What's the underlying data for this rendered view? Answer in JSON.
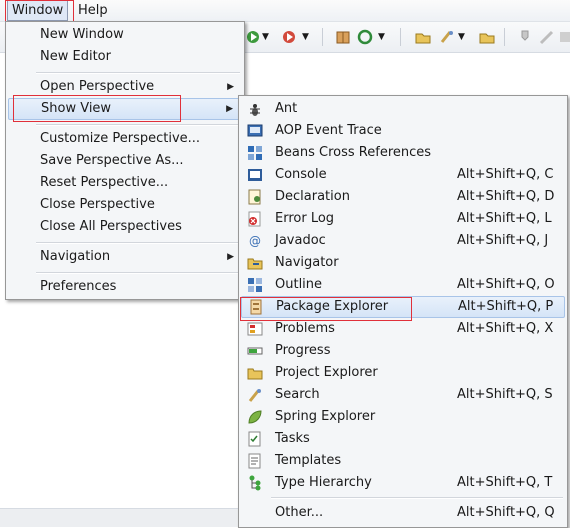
{
  "menubar": {
    "window": "Window",
    "help": "Help"
  },
  "window_menu": {
    "items": [
      {
        "label": "New Window"
      },
      {
        "label": "New Editor"
      },
      {
        "label": "Open Perspective"
      },
      {
        "label": "Show View"
      },
      {
        "label": "Customize Perspective..."
      },
      {
        "label": "Save Perspective As..."
      },
      {
        "label": "Reset Perspective..."
      },
      {
        "label": "Close Perspective"
      },
      {
        "label": "Close All Perspectives"
      },
      {
        "label": "Navigation"
      },
      {
        "label": "Preferences"
      }
    ]
  },
  "show_view_menu": {
    "items": [
      {
        "label": "Ant",
        "shortcut": "",
        "icon": "ant-icon"
      },
      {
        "label": "AOP Event Trace",
        "shortcut": "",
        "icon": "aop-event-trace-icon"
      },
      {
        "label": "Beans Cross References",
        "shortcut": "",
        "icon": "beans-cross-references-icon"
      },
      {
        "label": "Console",
        "shortcut": "Alt+Shift+Q, C",
        "icon": "console-icon"
      },
      {
        "label": "Declaration",
        "shortcut": "Alt+Shift+Q, D",
        "icon": "declaration-icon"
      },
      {
        "label": "Error Log",
        "shortcut": "Alt+Shift+Q, L",
        "icon": "error-log-icon"
      },
      {
        "label": "Javadoc",
        "shortcut": "Alt+Shift+Q, J",
        "icon": "javadoc-icon"
      },
      {
        "label": "Navigator",
        "shortcut": "",
        "icon": "navigator-icon"
      },
      {
        "label": "Outline",
        "shortcut": "Alt+Shift+Q, O",
        "icon": "outline-icon"
      },
      {
        "label": "Package Explorer",
        "shortcut": "Alt+Shift+Q, P",
        "icon": "package-explorer-icon"
      },
      {
        "label": "Problems",
        "shortcut": "Alt+Shift+Q, X",
        "icon": "problems-icon"
      },
      {
        "label": "Progress",
        "shortcut": "",
        "icon": "progress-icon"
      },
      {
        "label": "Project Explorer",
        "shortcut": "",
        "icon": "project-explorer-icon"
      },
      {
        "label": "Search",
        "shortcut": "Alt+Shift+Q, S",
        "icon": "search-icon"
      },
      {
        "label": "Spring Explorer",
        "shortcut": "",
        "icon": "spring-explorer-icon"
      },
      {
        "label": "Tasks",
        "shortcut": "",
        "icon": "tasks-icon"
      },
      {
        "label": "Templates",
        "shortcut": "",
        "icon": "templates-icon"
      },
      {
        "label": "Type Hierarchy",
        "shortcut": "Alt+Shift+Q, T",
        "icon": "type-hierarchy-icon"
      },
      {
        "label": "Other...",
        "shortcut": "Alt+Shift+Q, Q",
        "icon": ""
      }
    ]
  },
  "colors": {
    "highlight_border": "#e0303a",
    "menu_bg": "#f4f6f8",
    "selection": "#d5e4f7"
  }
}
